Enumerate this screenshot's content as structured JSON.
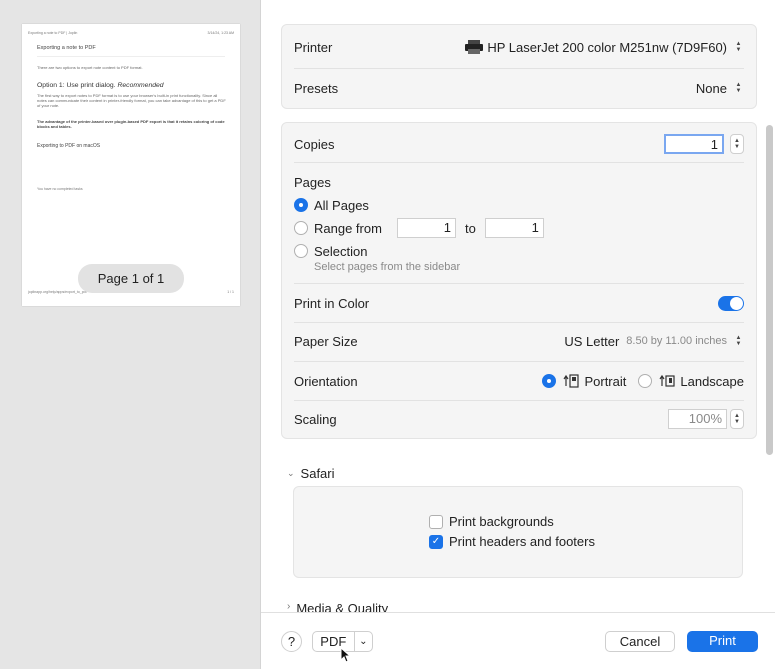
{
  "preview": {
    "header_left": "Exporting a note to PDF | Joplin",
    "header_right": "3/14/24, 1:23 AM",
    "title": "Exporting a note to PDF",
    "intro": "There are two options to export note content to PDF format.",
    "option_heading": "Option 1: Use print dialog.",
    "option_heading_em": "Recommended",
    "para1": "The first way to export notes to PDF format is to use your browser's built-in print functionality. Since all notes can communicate their content in printer-friendly format, you can take advantage of this to get a PDF of your note.",
    "para2": "The advantage of the printer-based over plugin-based PDF export is that it retains coloring of code blocks and tables.",
    "section_heading": "Exporting to PDF on macOS",
    "tasks_note": "You have no completed tasks",
    "footer_left": "joplinapp.org/help/apps/export_to_pdf",
    "footer_right": "1 / 1",
    "page_label": "Page 1 of 1"
  },
  "printer": {
    "label": "Printer",
    "value": "HP LaserJet 200 color M251nw (7D9F60)",
    "icon": "printer-icon"
  },
  "presets": {
    "label": "Presets",
    "value": "None"
  },
  "copies": {
    "label": "Copies",
    "value": "1"
  },
  "pages": {
    "label": "Pages",
    "all_pages": "All Pages",
    "range_label": "Range from",
    "range_from": "1",
    "range_to_label": "to",
    "range_to": "1",
    "selection": "Selection",
    "selection_hint": "Select pages from the sidebar"
  },
  "color": {
    "label": "Print in Color",
    "enabled": true
  },
  "paper": {
    "label": "Paper Size",
    "value": "US Letter",
    "detail": "8.50 by 11.00 inches"
  },
  "orientation": {
    "label": "Orientation",
    "portrait": "Portrait",
    "landscape": "Landscape",
    "selected": "Portrait"
  },
  "scaling": {
    "label": "Scaling",
    "value": "100%"
  },
  "safari": {
    "label": "Safari",
    "print_backgrounds": "Print backgrounds",
    "print_backgrounds_checked": false,
    "print_headers": "Print headers and footers",
    "print_headers_checked": true
  },
  "media_quality": {
    "label": "Media & Quality"
  },
  "footer": {
    "help": "?",
    "pdf": "PDF",
    "cancel": "Cancel",
    "print": "Print"
  },
  "colors": {
    "accent": "#1a73e8"
  }
}
